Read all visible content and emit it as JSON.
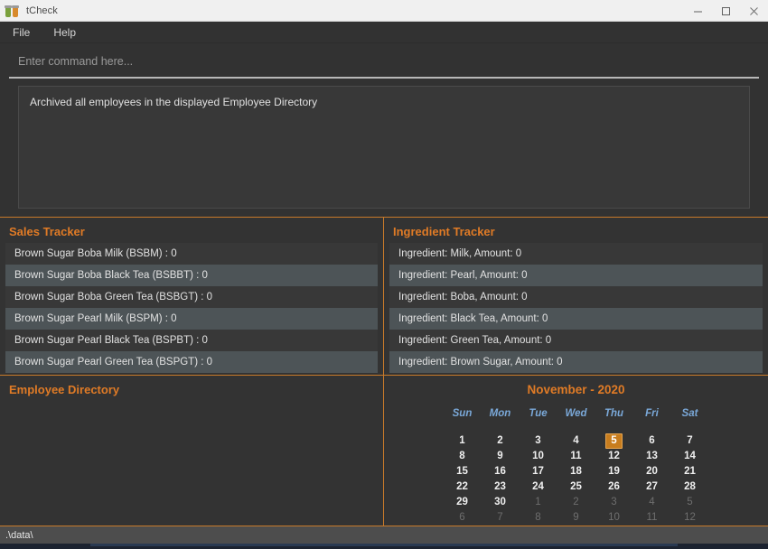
{
  "window": {
    "title": "tCheck",
    "icon": "boba-cups-icon",
    "controls": {
      "minimize": "minimize-icon",
      "maximize": "maximize-icon",
      "close": "close-icon"
    }
  },
  "menu": {
    "items": [
      {
        "label": "File"
      },
      {
        "label": "Help"
      }
    ]
  },
  "command": {
    "placeholder": "Enter command here...",
    "value": "",
    "result": "Archived all employees in the displayed Employee Directory"
  },
  "sales_tracker": {
    "title": "Sales Tracker",
    "items": [
      "Brown Sugar Boba Milk (BSBM) : 0",
      "Brown Sugar Boba Black Tea (BSBBT) : 0",
      "Brown Sugar Boba Green Tea (BSBGT) : 0",
      "Brown Sugar Pearl Milk (BSPM) : 0",
      "Brown Sugar Pearl Black Tea (BSPBT) : 0",
      "Brown Sugar Pearl Green Tea (BSPGT) : 0"
    ]
  },
  "ingredient_tracker": {
    "title": "Ingredient Tracker",
    "items": [
      "Ingredient: Milk,  Amount: 0",
      "Ingredient: Pearl,  Amount: 0",
      "Ingredient: Boba,  Amount: 0",
      "Ingredient: Black Tea,  Amount: 0",
      "Ingredient: Green Tea,  Amount: 0",
      "Ingredient: Brown Sugar,  Amount: 0"
    ]
  },
  "employee_directory": {
    "title": "Employee Directory",
    "items": []
  },
  "calendar": {
    "title": "November - 2020",
    "month": "November",
    "year": "2020",
    "day_headers": [
      "Sun",
      "Mon",
      "Tue",
      "Wed",
      "Thu",
      "Fri",
      "Sat"
    ],
    "today": 5,
    "accent_color": "#c87d1e",
    "weeks": [
      [
        {
          "day": "1",
          "muted": false
        },
        {
          "day": "2",
          "muted": false
        },
        {
          "day": "3",
          "muted": false
        },
        {
          "day": "4",
          "muted": false
        },
        {
          "day": "5",
          "muted": false,
          "today": true
        },
        {
          "day": "6",
          "muted": false
        },
        {
          "day": "7",
          "muted": false
        }
      ],
      [
        {
          "day": "8",
          "muted": false
        },
        {
          "day": "9",
          "muted": false
        },
        {
          "day": "10",
          "muted": false
        },
        {
          "day": "11",
          "muted": false
        },
        {
          "day": "12",
          "muted": false
        },
        {
          "day": "13",
          "muted": false
        },
        {
          "day": "14",
          "muted": false
        }
      ],
      [
        {
          "day": "15",
          "muted": false
        },
        {
          "day": "16",
          "muted": false
        },
        {
          "day": "17",
          "muted": false
        },
        {
          "day": "18",
          "muted": false
        },
        {
          "day": "19",
          "muted": false
        },
        {
          "day": "20",
          "muted": false
        },
        {
          "day": "21",
          "muted": false
        }
      ],
      [
        {
          "day": "22",
          "muted": false
        },
        {
          "day": "23",
          "muted": false
        },
        {
          "day": "24",
          "muted": false
        },
        {
          "day": "25",
          "muted": false
        },
        {
          "day": "26",
          "muted": false
        },
        {
          "day": "27",
          "muted": false
        },
        {
          "day": "28",
          "muted": false
        }
      ],
      [
        {
          "day": "29",
          "muted": false
        },
        {
          "day": "30",
          "muted": false
        },
        {
          "day": "1",
          "muted": true
        },
        {
          "day": "2",
          "muted": true
        },
        {
          "day": "3",
          "muted": true
        },
        {
          "day": "4",
          "muted": true
        },
        {
          "day": "5",
          "muted": true
        }
      ],
      [
        {
          "day": "6",
          "muted": true
        },
        {
          "day": "7",
          "muted": true
        },
        {
          "day": "8",
          "muted": true
        },
        {
          "day": "9",
          "muted": true
        },
        {
          "day": "10",
          "muted": true
        },
        {
          "day": "11",
          "muted": true
        },
        {
          "day": "12",
          "muted": true
        }
      ]
    ]
  },
  "status_bar": {
    "path": ".\\data\\"
  },
  "theme": {
    "accent": "#e07b26",
    "border_accent": "#c87a2a",
    "panel_bg": "#333333",
    "row_alt": "#4d5457",
    "dow_color": "#7aa8d8"
  }
}
